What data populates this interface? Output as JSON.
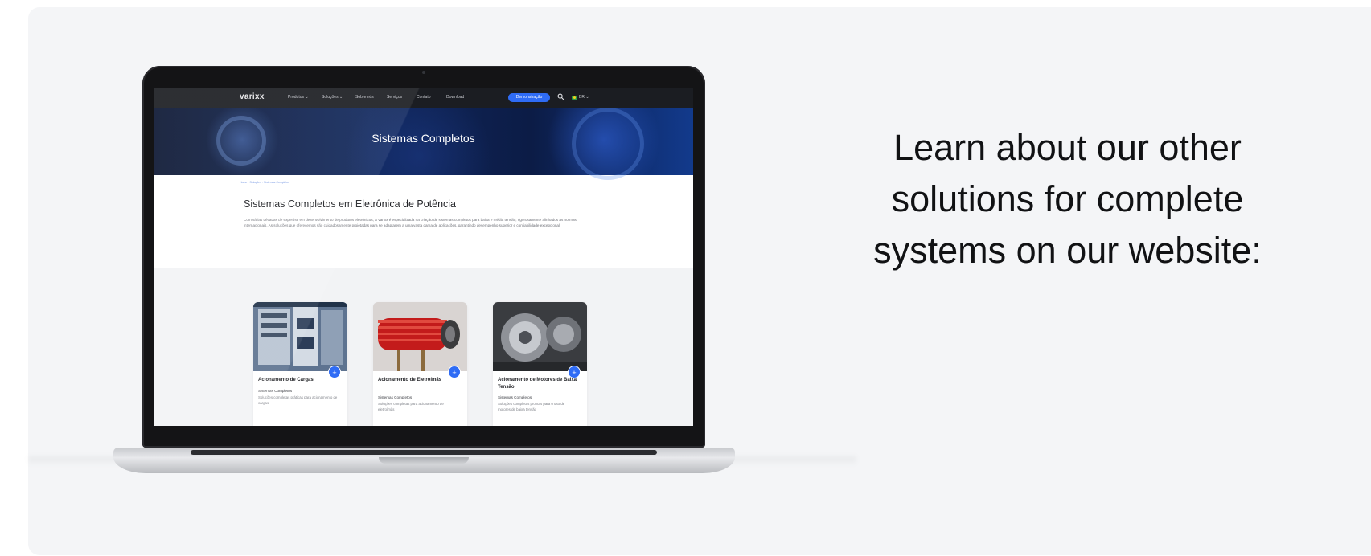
{
  "headline": "Learn about our other solutions for complete systems on our website:",
  "colors": {
    "accent": "#2f6cf5",
    "panel_bg": "#f4f5f7",
    "nav_bg": "#1b1d22"
  },
  "site": {
    "logo": "varixx",
    "nav": {
      "items": [
        {
          "label": "Produtos ⌄"
        },
        {
          "label": "Soluções ⌄"
        },
        {
          "label": "Sobre nós"
        },
        {
          "label": "Serviços"
        },
        {
          "label": "Contato"
        },
        {
          "label": "Download"
        }
      ],
      "cta": "Demonstração",
      "search_icon": "search-icon",
      "language": "BR ⌄"
    },
    "hero_title": "Sistemas Completos",
    "breadcrumb": "Home › Soluções › Sistemas Completos",
    "content_title": "Sistemas Completos em Eletrônica de Potência",
    "content_text": "Com várias décadas de expertise em desenvolvimento de produtos eletrônicos, a Varixx é especializada na criação de sistemas completos para baixa e média tensão, rigorosamente alinhados às normas internacionais. As soluções que oferecemos são cuidadosamente projetadas para se adaptarem a uma vasta gama de aplicações, garantindo desempenho superior e confiabilidade excepcional.",
    "cards": [
      {
        "title": "Acionamento de Cargas",
        "category": "Sistemas Completos",
        "description": "Soluções completas práticas para acionamento de cargas"
      },
      {
        "title": "Acionamento de Eletroímãs",
        "category": "Sistemas Completos",
        "description": "Soluções completas para acionamento de eletroímãs"
      },
      {
        "title": "Acionamento de Motores de Baixa Tensão",
        "category": "Sistemas Completos",
        "description": "Soluções completas prontas para o uso de motores de baixa tensão"
      }
    ]
  }
}
